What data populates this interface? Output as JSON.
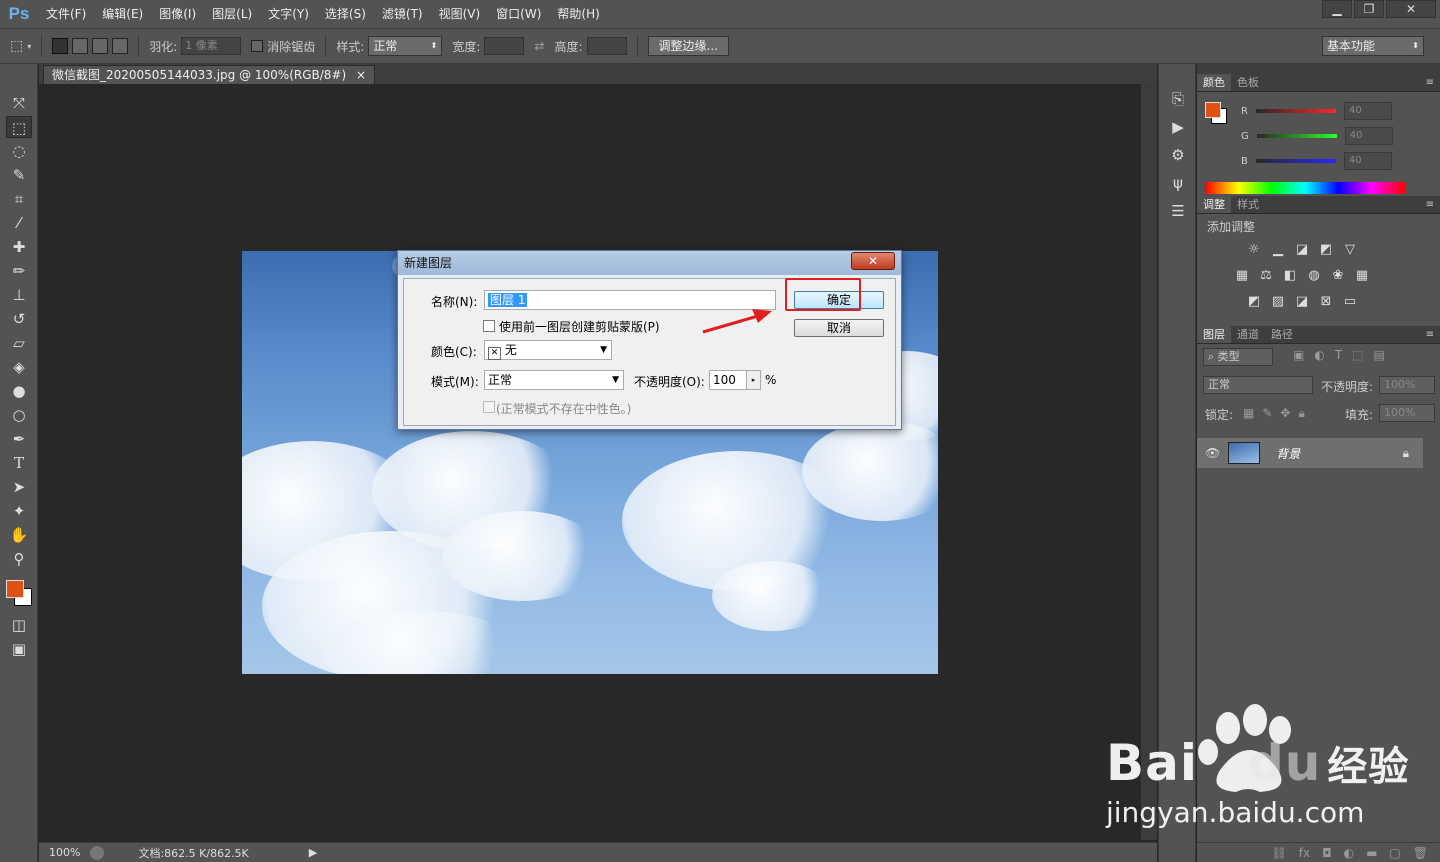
{
  "app": {
    "logo": "Ps"
  },
  "menu": [
    "文件(F)",
    "编辑(E)",
    "图像(I)",
    "图层(L)",
    "文字(Y)",
    "选择(S)",
    "滤镜(T)",
    "视图(V)",
    "窗口(W)",
    "帮助(H)"
  ],
  "window_controls": {
    "minimize": "▁",
    "restore": "❐",
    "close": "✕"
  },
  "options": {
    "feather_label": "羽化:",
    "feather_value": "1 像素",
    "antialias_label": "消除锯齿",
    "style_label": "样式:",
    "style_value": "正常",
    "width_label": "宽度:",
    "height_label": "高度:",
    "refine_button": "调整边缘...",
    "workspace": "基本功能"
  },
  "document": {
    "tab_title": "微信截图_20200505144033.jpg @ 100%(RGB/8#)",
    "tab_close": "×"
  },
  "status": {
    "zoom": "100%",
    "doc_size": "文档:862.5 K/862.5K"
  },
  "dialog": {
    "title": "新建图层",
    "close_glyph": "✕",
    "name_label": "名称(N):",
    "name_value": "图层 1",
    "clip_label": "使用前一图层创建剪贴蒙版(P)",
    "color_label": "颜色(C):",
    "color_value": "无",
    "color_x": "✕",
    "mode_label": "模式(M):",
    "mode_value": "正常",
    "opacity_label": "不透明度(O):",
    "opacity_value": "100",
    "opacity_unit": "%",
    "neutral_label": "(正常模式不存在中性色。)",
    "ok_button": "确定",
    "cancel_button": "取消"
  },
  "panels": {
    "color_tabs": [
      "颜色",
      "色板"
    ],
    "rgb": [
      {
        "label": "R",
        "value": "40"
      },
      {
        "label": "G",
        "value": "40"
      },
      {
        "label": "B",
        "value": "40"
      }
    ],
    "adjust_tabs": [
      "调整",
      "样式"
    ],
    "adjust_title": "添加调整",
    "layers_tabs": [
      "图层",
      "通道",
      "路径"
    ],
    "filter_kind": "类型",
    "blend_mode": "正常",
    "opacity_label": "不透明度:",
    "opacity_value": "100%",
    "lock_label": "锁定:",
    "fill_label": "填充:",
    "fill_value": "100%",
    "layer_name": "背景"
  },
  "watermark": {
    "brand": "Bai",
    "brand2": "du",
    "cn": "经验",
    "url": "jingyan.baidu.com"
  },
  "colors": {
    "foreground": "#e0520f",
    "accent_red": "#e02020",
    "panel": "#535353"
  }
}
